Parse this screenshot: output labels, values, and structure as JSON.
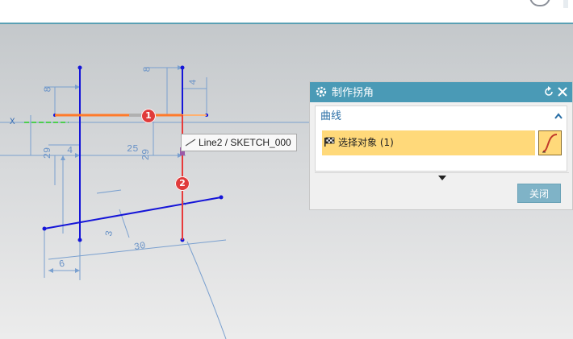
{
  "dimensions": [
    "8",
    "8",
    "4",
    "29",
    "4",
    "25",
    "29",
    "3",
    "30",
    "6"
  ],
  "axis_label": "X",
  "markers": [
    "1",
    "2"
  ],
  "tooltip": {
    "text": "Line2 / SKETCH_000",
    "icon": "line-icon"
  },
  "dialog": {
    "title": "制作拐角",
    "section_label": "曲线",
    "select_label": "选择对象 (1)",
    "close_label": "关闭",
    "icons": [
      "gear-icon",
      "reset-icon",
      "close-icon",
      "collapse-icon",
      "flag-icon",
      "curve-icon",
      "expand-icon"
    ]
  },
  "colors": {
    "dialog_title": "#4a9ab6",
    "selection_bg": "#ffd97a",
    "dimension": "#6a93c7",
    "sketch_blue": "#1515d8",
    "highlight_orange": "#ff8c3a",
    "highlight_red": "#e83a3a",
    "marker_red": "#e03b3b"
  }
}
